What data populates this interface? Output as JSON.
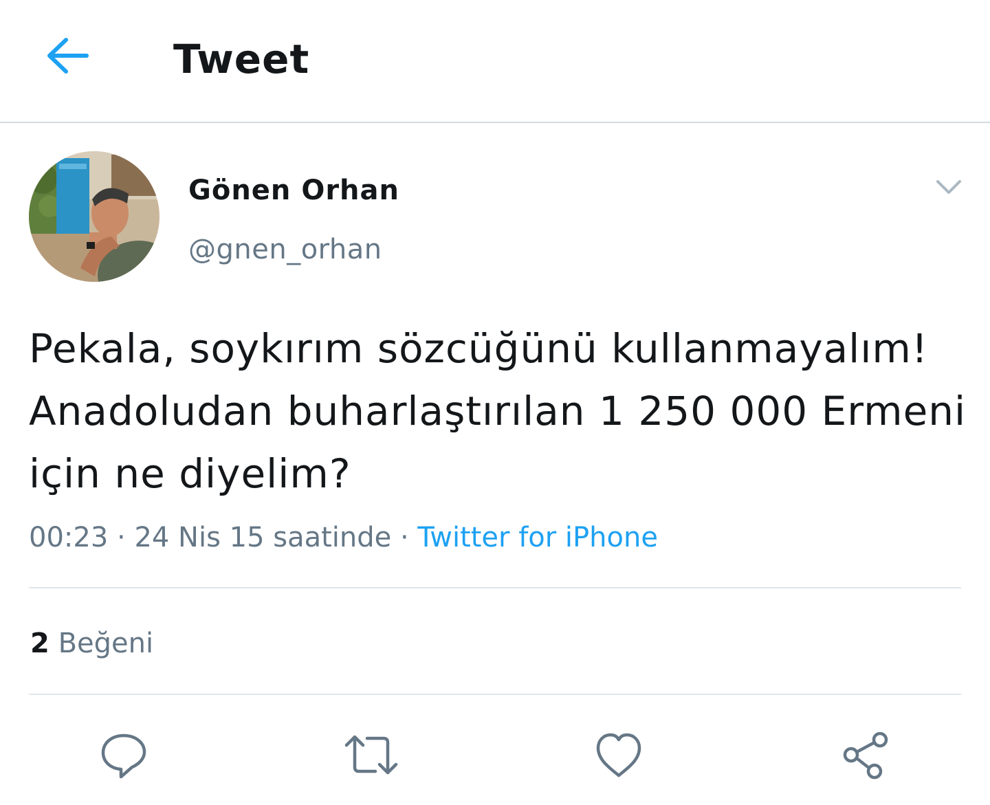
{
  "colors": {
    "accent": "#1da1f2",
    "text_primary": "#14171a",
    "text_secondary": "#657786",
    "divider": "#dfe5ea"
  },
  "header": {
    "title": "Tweet",
    "back_icon": "arrow-left-icon"
  },
  "tweet": {
    "author": {
      "display_name": "Gönen Orhan",
      "handle": "@gnen_orhan",
      "avatar": "profile-photo"
    },
    "menu_icon": "chevron-down-icon",
    "text": "Pekala, soykırım sözcüğünü kullanmayalım!\nAnadoludan buharlaştırılan 1 250 000 Ermeni için ne diyelim?",
    "meta": {
      "time": "00:23",
      "separator": " · ",
      "date": "24 Nis 15 saatinde",
      "source": "Twitter for iPhone"
    },
    "stats": {
      "likes_count": "2",
      "likes_label": "Beğeni"
    }
  },
  "actions": [
    {
      "name": "reply",
      "icon": "reply-icon"
    },
    {
      "name": "retweet",
      "icon": "retweet-icon"
    },
    {
      "name": "like",
      "icon": "heart-icon"
    },
    {
      "name": "share",
      "icon": "share-icon"
    }
  ]
}
